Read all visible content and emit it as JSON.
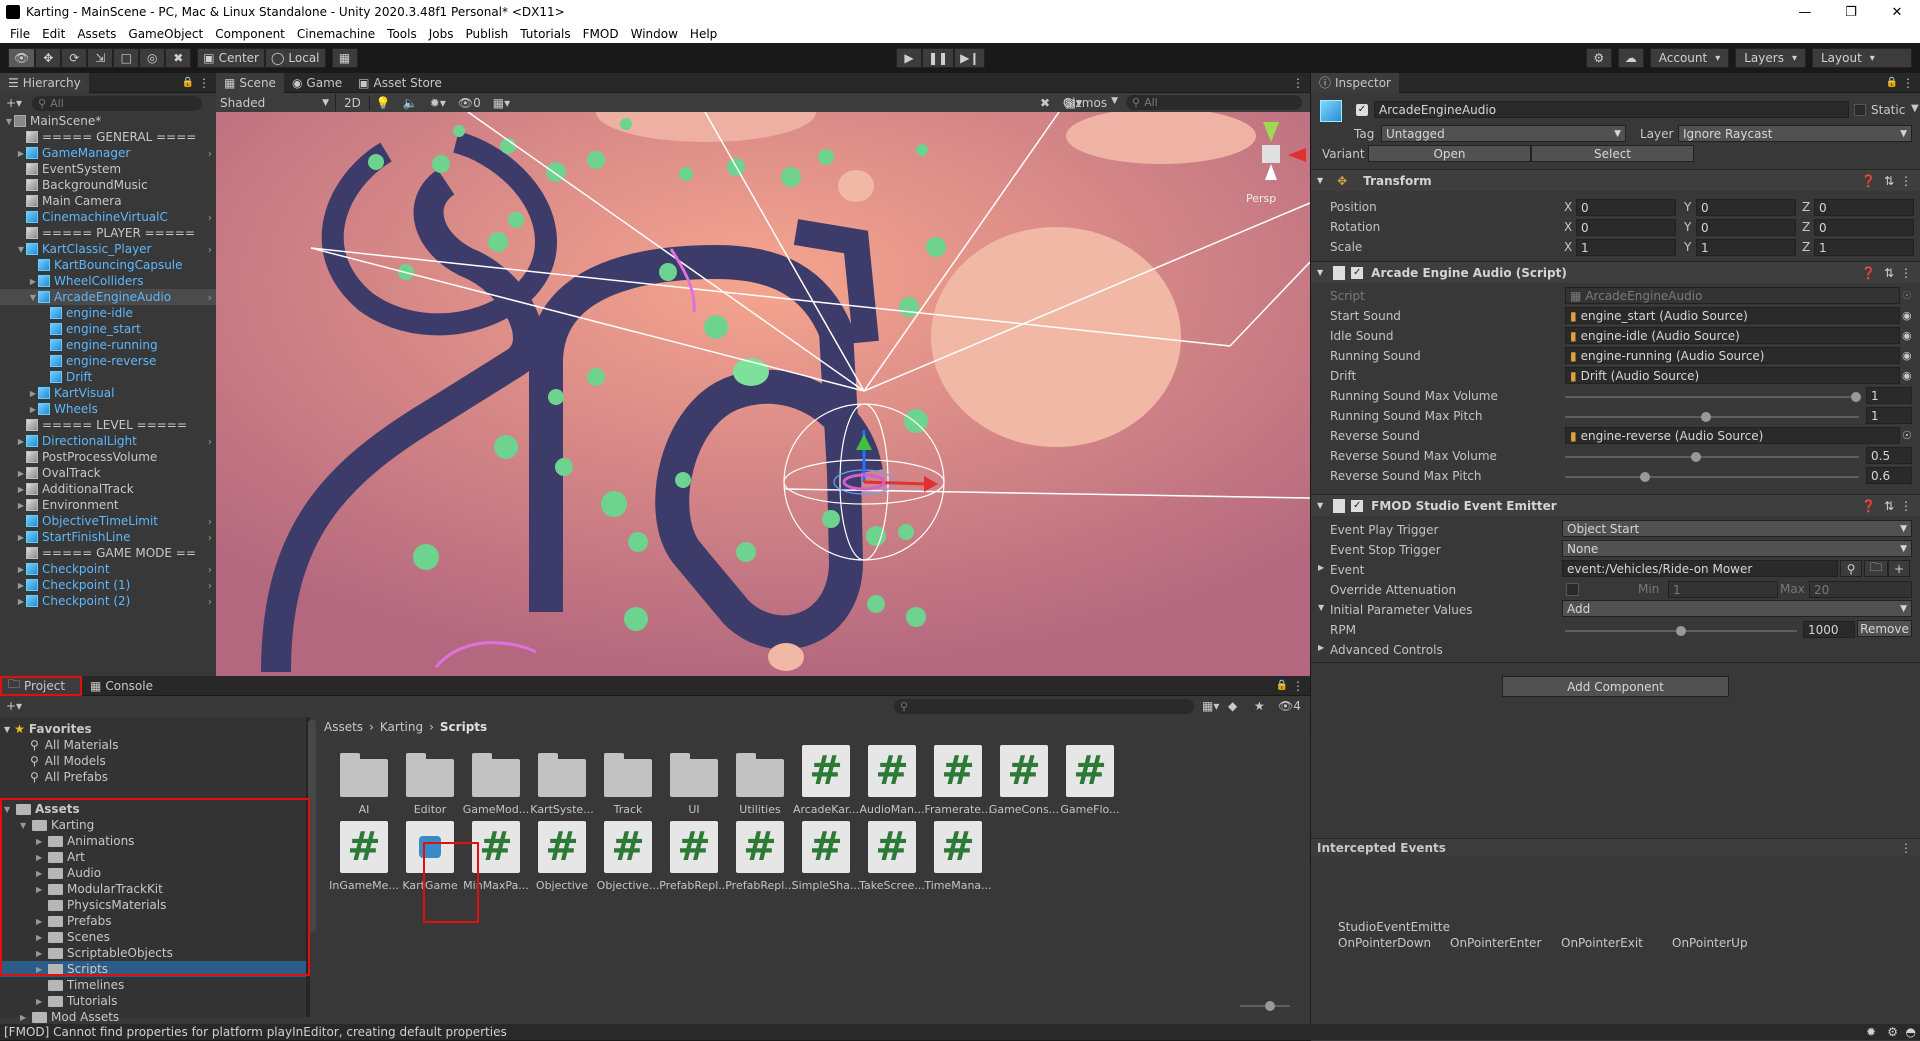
{
  "window": {
    "title": "Karting - MainScene - PC, Mac & Linux Standalone - Unity 2020.3.48f1 Personal* <DX11>"
  },
  "menu": [
    "File",
    "Edit",
    "Assets",
    "GameObject",
    "Component",
    "Cinemachine",
    "Tools",
    "Jobs",
    "Publish",
    "Tutorials",
    "FMOD",
    "Window",
    "Help"
  ],
  "toolbar": {
    "center": "Center",
    "local": "Local",
    "account": "Account",
    "layers": "Layers",
    "layout": "Layout"
  },
  "hierarchy": {
    "tab": "Hierarchy",
    "search_placeholder": "All",
    "items": [
      {
        "label": "MainScene*",
        "indent": 0,
        "arrow": "▼",
        "icon": "scene"
      },
      {
        "label": "===== GENERAL ====",
        "indent": 1,
        "icon": "cube"
      },
      {
        "label": "GameManager",
        "indent": 1,
        "arrow": "▶",
        "icon": "blue",
        "blue": true,
        "chev": true
      },
      {
        "label": "EventSystem",
        "indent": 1,
        "icon": "cube"
      },
      {
        "label": "BackgroundMusic",
        "indent": 1,
        "icon": "cube"
      },
      {
        "label": "Main Camera",
        "indent": 1,
        "icon": "cube"
      },
      {
        "label": "CinemachineVirtualC",
        "indent": 1,
        "icon": "blue",
        "blue": true,
        "chev": true
      },
      {
        "label": "===== PLAYER =====",
        "indent": 1,
        "icon": "cube"
      },
      {
        "label": "KartClassic_Player",
        "indent": 1,
        "arrow": "▼",
        "icon": "blue",
        "blue": true,
        "chev": true
      },
      {
        "label": "KartBouncingCapsule",
        "indent": 2,
        "icon": "blue",
        "blue": true
      },
      {
        "label": "WheelColliders",
        "indent": 2,
        "arrow": "▶",
        "icon": "blue",
        "blue": true
      },
      {
        "label": "ArcadeEngineAudio",
        "indent": 2,
        "arrow": "▼",
        "icon": "blue",
        "blue": true,
        "chev": true,
        "sel": true
      },
      {
        "label": "engine-idle",
        "indent": 3,
        "icon": "blue",
        "blue": true
      },
      {
        "label": "engine_start",
        "indent": 3,
        "icon": "blue",
        "blue": true
      },
      {
        "label": "engine-running",
        "indent": 3,
        "icon": "blue",
        "blue": true
      },
      {
        "label": "engine-reverse",
        "indent": 3,
        "icon": "blue",
        "blue": true
      },
      {
        "label": "Drift",
        "indent": 3,
        "icon": "blue",
        "blue": true
      },
      {
        "label": "KartVisual",
        "indent": 2,
        "arrow": "▶",
        "icon": "blue",
        "blue": true
      },
      {
        "label": "Wheels",
        "indent": 2,
        "arrow": "▶",
        "icon": "blue",
        "blue": true
      },
      {
        "label": "===== LEVEL =====",
        "indent": 1,
        "icon": "cube"
      },
      {
        "label": "DirectionalLight",
        "indent": 1,
        "arrow": "▶",
        "icon": "blue",
        "blue": true,
        "chev": true
      },
      {
        "label": "PostProcessVolume",
        "indent": 1,
        "icon": "cube"
      },
      {
        "label": "OvalTrack",
        "indent": 1,
        "arrow": "▶",
        "icon": "cube"
      },
      {
        "label": "AdditionalTrack",
        "indent": 1,
        "arrow": "▶",
        "icon": "cube"
      },
      {
        "label": "Environment",
        "indent": 1,
        "arrow": "▶",
        "icon": "cube"
      },
      {
        "label": "ObjectiveTimeLimit",
        "indent": 1,
        "icon": "blue",
        "blue": true,
        "chev": true
      },
      {
        "label": "StartFinishLine",
        "indent": 1,
        "arrow": "▶",
        "icon": "blue",
        "blue": true,
        "chev": true
      },
      {
        "label": "===== GAME MODE ==",
        "indent": 1,
        "icon": "cube"
      },
      {
        "label": "Checkpoint",
        "indent": 1,
        "arrow": "▶",
        "icon": "blue",
        "blue": true,
        "chev": true
      },
      {
        "label": "Checkpoint (1)",
        "indent": 1,
        "arrow": "▶",
        "icon": "blue",
        "blue": true,
        "chev": true
      },
      {
        "label": "Checkpoint (2)",
        "indent": 1,
        "arrow": "▶",
        "icon": "blue",
        "blue": true,
        "chev": true
      }
    ]
  },
  "scene": {
    "tabs": [
      "Scene",
      "Game",
      "Asset Store"
    ],
    "shading": "Shaded",
    "mode2d": "2D",
    "hidden_count": "0",
    "gizmos": "Gizmos",
    "search_placeholder": "All",
    "persp": "Persp"
  },
  "inspector": {
    "tab": "Inspector",
    "object_name": "ArcadeEngineAudio",
    "static": "Static",
    "tag_label": "Tag",
    "tag": "Untagged",
    "layer_label": "Layer",
    "layer": "Ignore Raycast",
    "variant_label": "Variant",
    "open": "Open",
    "select": "Select",
    "transform": {
      "title": "Transform",
      "rows": [
        {
          "label": "Position",
          "x": "0",
          "y": "0",
          "z": "0"
        },
        {
          "label": "Rotation",
          "x": "0",
          "y": "0",
          "z": "0"
        },
        {
          "label": "Scale",
          "x": "1",
          "y": "1",
          "z": "1"
        }
      ]
    },
    "script": {
      "title": "Arcade Engine Audio (Script)",
      "script_label": "Script",
      "script_value": "ArcadeEngineAudio",
      "refs": [
        {
          "label": "Start Sound",
          "value": "engine_start (Audio Source)"
        },
        {
          "label": "Idle Sound",
          "value": "engine-idle (Audio Source)"
        },
        {
          "label": "Running Sound",
          "value": "engine-running (Audio Source)"
        },
        {
          "label": "Drift",
          "value": "Drift (Audio Source)"
        }
      ],
      "running_max_volume_label": "Running Sound Max Volume",
      "running_max_volume": "1",
      "running_max_pitch_label": "Running Sound Max Pitch",
      "running_max_pitch": "1",
      "reverse_label": "Reverse Sound",
      "reverse_value": "engine-reverse (Audio Source)",
      "reverse_max_volume_label": "Reverse Sound Max Volume",
      "reverse_max_volume": "0.5",
      "reverse_max_pitch_label": "Reverse Sound Max Pitch",
      "reverse_max_pitch": "0.6"
    },
    "fmod": {
      "title": "FMOD Studio Event Emitter",
      "play_trigger_label": "Event Play Trigger",
      "play_trigger": "Object Start",
      "stop_trigger_label": "Event Stop Trigger",
      "stop_trigger": "None",
      "event_label": "Event",
      "event": "event:/Vehicles/Ride-on Mower",
      "override_label": "Override Attenuation",
      "min_label": "Min",
      "min": "1",
      "max_label": "Max",
      "max": "20",
      "initial_params_label": "Initial Parameter Values",
      "add": "Add",
      "rpm_label": "RPM",
      "rpm": "1000",
      "remove": "Remove",
      "advanced": "Advanced Controls"
    },
    "add_component": "Add Component",
    "intercepted": {
      "title": "Intercepted Events",
      "emitter": "StudioEventEmitte",
      "events": [
        "OnPointerDown",
        "OnPointerEnter",
        "OnPointerExit",
        "OnPointerUp"
      ]
    }
  },
  "project": {
    "tabs": [
      "Project",
      "Console"
    ],
    "hidden_count": "4",
    "breadcrumb": [
      "Assets",
      "Karting",
      "Scripts"
    ],
    "favorites": {
      "label": "Favorites",
      "items": [
        "All Materials",
        "All Models",
        "All Prefabs"
      ]
    },
    "tree": [
      {
        "label": "Assets",
        "indent": 0,
        "arrow": "▼",
        "bold": true
      },
      {
        "label": "Karting",
        "indent": 1,
        "arrow": "▼"
      },
      {
        "label": "Animations",
        "indent": 2,
        "arrow": "▶"
      },
      {
        "label": "Art",
        "indent": 2,
        "arrow": "▶"
      },
      {
        "label": "Audio",
        "indent": 2,
        "arrow": "▶"
      },
      {
        "label": "ModularTrackKit",
        "indent": 2,
        "arrow": "▶"
      },
      {
        "label": "PhysicsMaterials",
        "indent": 2
      },
      {
        "label": "Prefabs",
        "indent": 2,
        "arrow": "▶"
      },
      {
        "label": "Scenes",
        "indent": 2,
        "arrow": "▶"
      },
      {
        "label": "ScriptableObjects",
        "indent": 2,
        "arrow": "▶"
      },
      {
        "label": "Scripts",
        "indent": 2,
        "arrow": "▶",
        "sel": true
      },
      {
        "label": "Timelines",
        "indent": 2
      },
      {
        "label": "Tutorials",
        "indent": 2,
        "arrow": "▶"
      },
      {
        "label": "Mod Assets",
        "indent": 1,
        "arrow": "▶"
      }
    ],
    "assets_row1": [
      {
        "label": "AI",
        "type": "folder"
      },
      {
        "label": "Editor",
        "type": "folder"
      },
      {
        "label": "GameMod...",
        "type": "folder"
      },
      {
        "label": "KartSyste...",
        "type": "folder"
      },
      {
        "label": "Track",
        "type": "folder"
      },
      {
        "label": "UI",
        "type": "folder"
      },
      {
        "label": "Utilities",
        "type": "folder"
      },
      {
        "label": "ArcadeKar...",
        "type": "script"
      },
      {
        "label": "AudioMan...",
        "type": "script"
      },
      {
        "label": "Framerate...",
        "type": "script"
      },
      {
        "label": "GameCons...",
        "type": "script"
      },
      {
        "label": "GameFlo...",
        "type": "script"
      }
    ],
    "assets_row2": [
      {
        "label": "InGameMe...",
        "type": "script"
      },
      {
        "label": "KartGame",
        "type": "asmdef"
      },
      {
        "label": "MinMaxPa...",
        "type": "script"
      },
      {
        "label": "Objective",
        "type": "script"
      },
      {
        "label": "Objective...",
        "type": "script"
      },
      {
        "label": "PrefabRepl...",
        "type": "script"
      },
      {
        "label": "PrefabRepl...",
        "type": "script"
      },
      {
        "label": "SimpleSha...",
        "type": "script"
      },
      {
        "label": "TakeScree...",
        "type": "script"
      },
      {
        "label": "TimeMana...",
        "type": "script"
      }
    ]
  },
  "status": {
    "message": "[FMOD] Cannot find properties for platform playInEditor, creating default properties"
  }
}
